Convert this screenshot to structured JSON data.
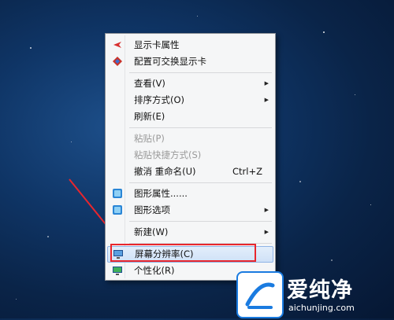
{
  "menu": {
    "items": [
      {
        "label": "显示卡属性"
      },
      {
        "label": "配置可交换显示卡"
      },
      {
        "label": "查看(V)"
      },
      {
        "label": "排序方式(O)"
      },
      {
        "label": "刷新(E)"
      },
      {
        "label": "粘贴(P)"
      },
      {
        "label": "粘贴快捷方式(S)"
      },
      {
        "label": "撤消 重命名(U)",
        "shortcut": "Ctrl+Z"
      },
      {
        "label": "图形属性......"
      },
      {
        "label": "图形选项"
      },
      {
        "label": "新建(W)"
      },
      {
        "label": "屏幕分辨率(C)"
      },
      {
        "label": "个性化(R)"
      }
    ]
  },
  "watermark": {
    "text": "爱纯净",
    "url": "aichunjing.com"
  },
  "colors": {
    "highlight_border": "#e8262d",
    "menu_bg": "#f5f6f7",
    "desktop": "#0f3566"
  }
}
